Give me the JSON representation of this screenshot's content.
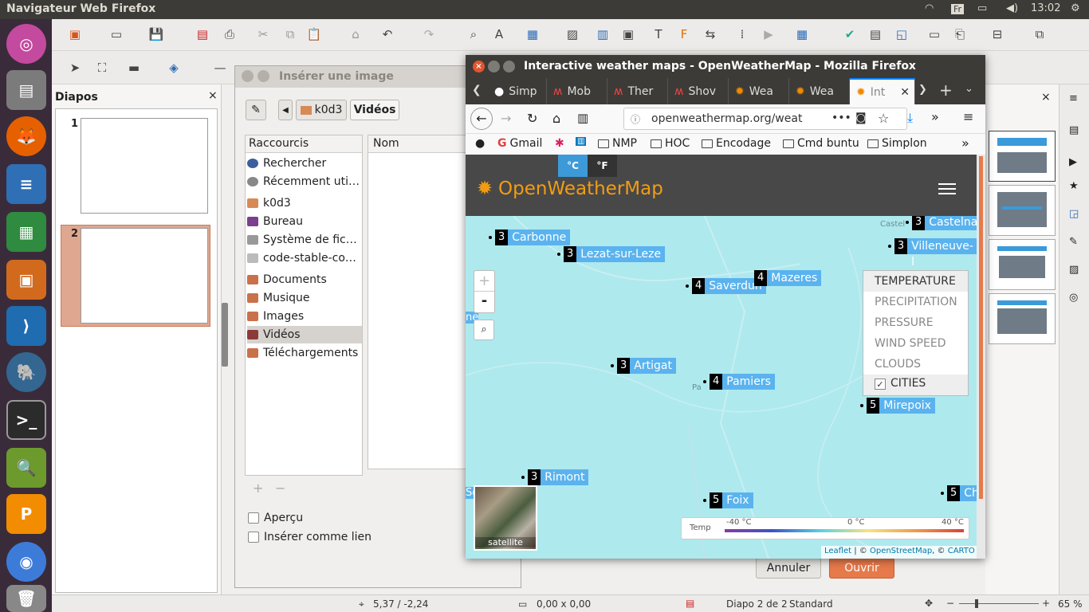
{
  "topbar": {
    "title": "Navigateur Web Firefox",
    "lang": "Fr",
    "time": "13:02"
  },
  "slides": {
    "pane_title": "Diapos",
    "items": [
      "1",
      "2"
    ]
  },
  "dialog": {
    "title": "Insérer une image",
    "path_button": "k0d3",
    "path_current": "Vidéos",
    "places_header": "Raccourcis",
    "name_header": "Nom",
    "places": [
      "Rechercher",
      "Récemment uti…",
      "k0d3",
      "Bureau",
      "Système de fic…",
      "code-stable-co…",
      "Documents",
      "Musique",
      "Images",
      "Vidéos",
      "Téléchargements"
    ],
    "preview_label": "Aperçu",
    "link_label": "Insérer comme lien",
    "cancel": "Annuler",
    "open": "Ouvrir"
  },
  "firefox": {
    "title": "Interactive weather maps - OpenWeatherMap - Mozilla Firefox",
    "tabs": [
      "Simp",
      "Mob",
      "Ther",
      "Shov",
      "Wea",
      "Wea",
      "Int"
    ],
    "url": "openweathermap.org/weat",
    "bookmarks": [
      "Gmail",
      "NMP",
      "HOC",
      "Encodage",
      "Cmd buntu",
      "Simplon"
    ]
  },
  "owm": {
    "unit_c": "°C",
    "unit_f": "°F",
    "logo": "OpenWeatherMap",
    "cities": [
      {
        "n": "3",
        "name": "Carbonne"
      },
      {
        "n": "3",
        "name": "Lezat-sur-Leze"
      },
      {
        "n": "4",
        "name": "Saverdun"
      },
      {
        "n": "4",
        "name": "Mazeres"
      },
      {
        "n": "3",
        "name": "Artigat"
      },
      {
        "n": "4",
        "name": "Pamiers"
      },
      {
        "n": "5",
        "name": "Mirepoix"
      },
      {
        "n": "3",
        "name": "Rimont"
      },
      {
        "n": "5",
        "name": "Foix"
      },
      {
        "n": "3",
        "name": "Castelna"
      },
      {
        "n": "3",
        "name": "Villeneuve-l"
      },
      {
        "n": "5",
        "name": "Ch"
      }
    ],
    "layers": [
      "TEMPERATURE",
      "PRECIPITATION",
      "PRESSURE",
      "WIND SPEED",
      "CLOUDS",
      "CITIES"
    ],
    "zoom_in": "+",
    "zoom_out": "-",
    "satellite": "satellite",
    "legend": {
      "label": "Temp",
      "min": "-40 °C",
      "mid": "0 °C",
      "max": "40 °C"
    },
    "attribution_leaflet": "Leaflet",
    "attribution_sep": " | © ",
    "attribution_osm": "OpenStreetMap",
    "attribution_sep2": ", © ",
    "attribution_carto": "CARTO",
    "map_labels": [
      "Castel",
      "Pa",
      "ne",
      "Se"
    ]
  },
  "statusbar": {
    "coords": "5,37 / -2,24",
    "size": "0,00 x 0,00",
    "slide": "Diapo 2 de 2",
    "layout": "Standard",
    "zoom": "65 %"
  }
}
